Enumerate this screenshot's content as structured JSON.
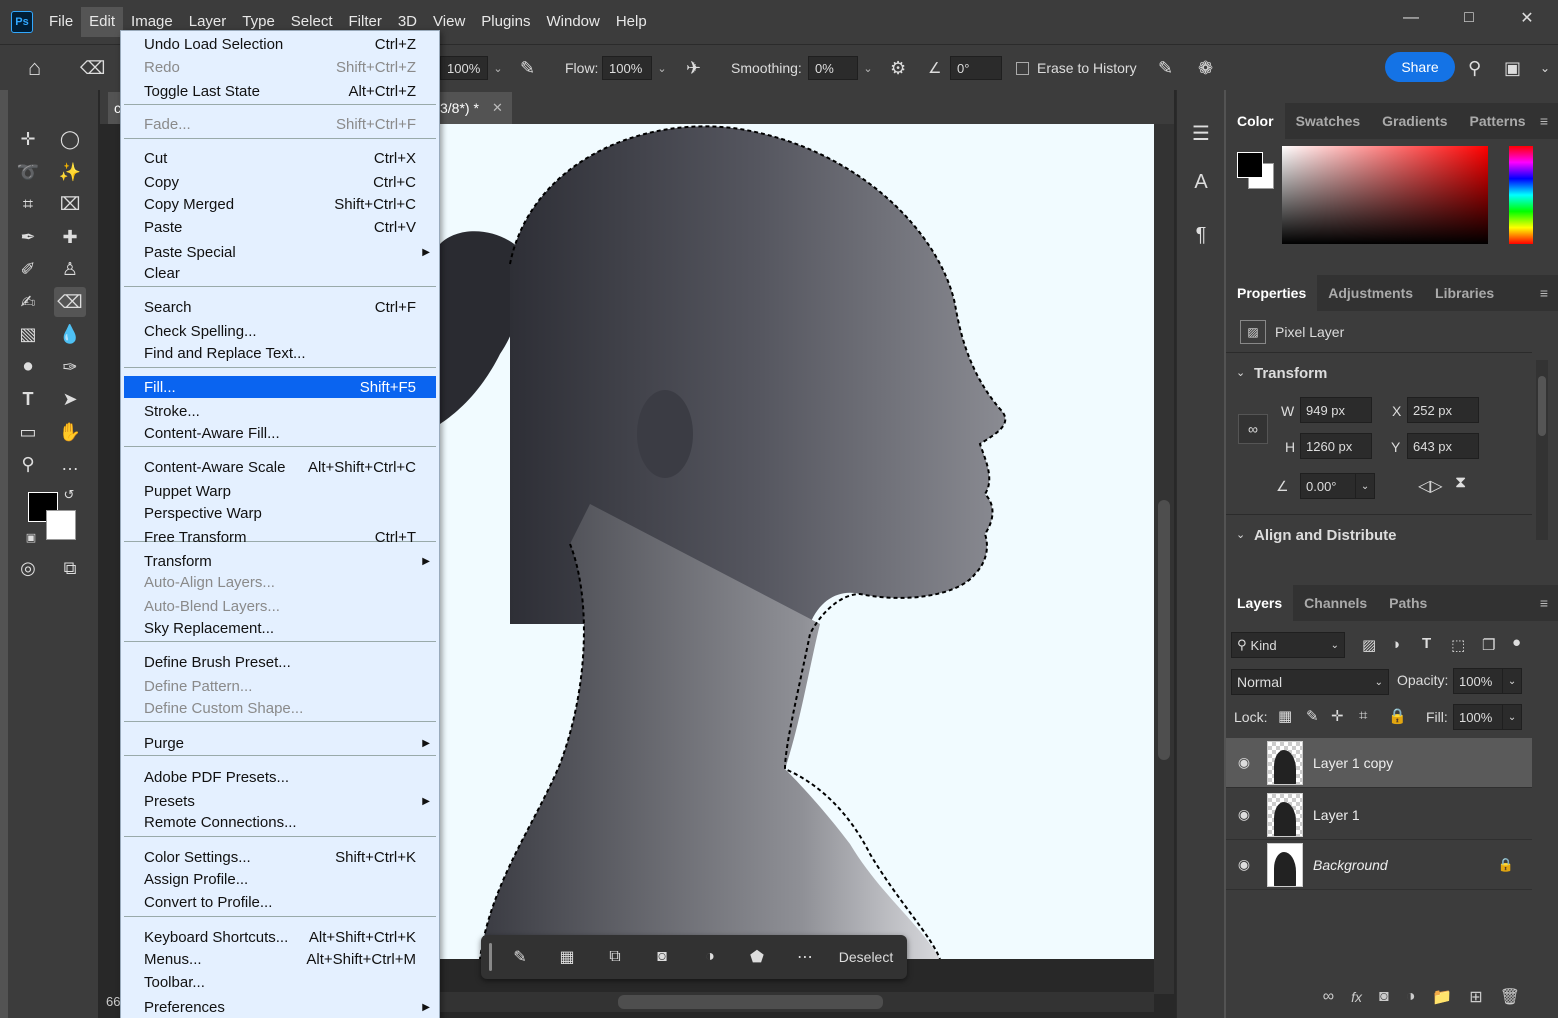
{
  "app": {
    "logo": "Ps"
  },
  "menubar": {
    "items": [
      "File",
      "Edit",
      "Image",
      "Layer",
      "Type",
      "Select",
      "Filter",
      "3D",
      "View",
      "Plugins",
      "Window",
      "Help"
    ],
    "active": "Edit"
  },
  "options": {
    "opacity_value": "100%",
    "flow_label": "Flow:",
    "flow_value": "100%",
    "smoothing_label": "Smoothing:",
    "smoothing_value": "0%",
    "angle_value": "0°",
    "erase_to_history": "Erase to History",
    "share": "Share"
  },
  "document": {
    "tab_title_visible": "3/8*) *",
    "tab_prefix": "c",
    "zoom": "66"
  },
  "edit_menu": {
    "items": [
      {
        "label": "Undo Load Selection",
        "shortcut": "Ctrl+Z",
        "disabled": false
      },
      {
        "label": "Redo",
        "shortcut": "Shift+Ctrl+Z",
        "disabled": true
      },
      {
        "label": "Toggle Last State",
        "shortcut": "Alt+Ctrl+Z",
        "disabled": false
      },
      {
        "label": "Fade...",
        "shortcut": "Shift+Ctrl+F",
        "disabled": true
      },
      {
        "label": "Cut",
        "shortcut": "Ctrl+X",
        "disabled": false
      },
      {
        "label": "Copy",
        "shortcut": "Ctrl+C",
        "disabled": false
      },
      {
        "label": "Copy Merged",
        "shortcut": "Shift+Ctrl+C",
        "disabled": false
      },
      {
        "label": "Paste",
        "shortcut": "Ctrl+V",
        "disabled": false
      },
      {
        "label": "Paste Special",
        "shortcut": "",
        "submenu": true
      },
      {
        "label": "Clear",
        "shortcut": ""
      },
      {
        "label": "Search",
        "shortcut": "Ctrl+F"
      },
      {
        "label": "Check Spelling...",
        "shortcut": ""
      },
      {
        "label": "Find and Replace Text...",
        "shortcut": ""
      },
      {
        "label": "Fill...",
        "shortcut": "Shift+F5",
        "highlighted": true
      },
      {
        "label": "Stroke...",
        "shortcut": ""
      },
      {
        "label": "Content-Aware Fill...",
        "shortcut": ""
      },
      {
        "label": "Content-Aware Scale",
        "shortcut": "Alt+Shift+Ctrl+C"
      },
      {
        "label": "Puppet Warp",
        "shortcut": ""
      },
      {
        "label": "Perspective Warp",
        "shortcut": ""
      },
      {
        "label": "Free Transform",
        "shortcut": "Ctrl+T"
      },
      {
        "label": "Transform",
        "shortcut": "",
        "submenu": true
      },
      {
        "label": "Auto-Align Layers...",
        "shortcut": "",
        "disabled": true
      },
      {
        "label": "Auto-Blend Layers...",
        "shortcut": "",
        "disabled": true
      },
      {
        "label": "Sky Replacement...",
        "shortcut": ""
      },
      {
        "label": "Define Brush Preset...",
        "shortcut": ""
      },
      {
        "label": "Define Pattern...",
        "shortcut": "",
        "disabled": true
      },
      {
        "label": "Define Custom Shape...",
        "shortcut": "",
        "disabled": true
      },
      {
        "label": "Purge",
        "shortcut": "",
        "submenu": true
      },
      {
        "label": "Adobe PDF Presets...",
        "shortcut": ""
      },
      {
        "label": "Presets",
        "shortcut": "",
        "submenu": true
      },
      {
        "label": "Remote Connections...",
        "shortcut": ""
      },
      {
        "label": "Color Settings...",
        "shortcut": "Shift+Ctrl+K"
      },
      {
        "label": "Assign Profile...",
        "shortcut": ""
      },
      {
        "label": "Convert to Profile...",
        "shortcut": ""
      },
      {
        "label": "Keyboard Shortcuts...",
        "shortcut": "Alt+Shift+Ctrl+K"
      },
      {
        "label": "Menus...",
        "shortcut": "Alt+Shift+Ctrl+M"
      },
      {
        "label": "Toolbar...",
        "shortcut": ""
      },
      {
        "label": "Preferences",
        "shortcut": "",
        "submenu": true
      }
    ]
  },
  "color_panel": {
    "tabs": [
      "Color",
      "Swatches",
      "Gradients",
      "Patterns"
    ],
    "active": "Color",
    "foreground": "#000000",
    "background": "#ffffff"
  },
  "properties_panel": {
    "tabs": [
      "Properties",
      "Adjustments",
      "Libraries"
    ],
    "active": "Properties",
    "layer_type": "Pixel Layer",
    "transform_title": "Transform",
    "w_label": "W",
    "w": "949 px",
    "h_label": "H",
    "h": "1260 px",
    "x_label": "X",
    "x": "252 px",
    "y_label": "Y",
    "y": "643 px",
    "angle": "0.00°",
    "align_title": "Align and Distribute"
  },
  "layers_panel": {
    "tabs": [
      "Layers",
      "Channels",
      "Paths"
    ],
    "active": "Layers",
    "filter_kind": "Kind",
    "blend_mode": "Normal",
    "opacity_label": "Opacity:",
    "opacity": "100%",
    "lock_label": "Lock:",
    "fill_label": "Fill:",
    "fill": "100%",
    "layers": [
      {
        "name": "Layer 1 copy",
        "selected": true
      },
      {
        "name": "Layer 1",
        "selected": false
      },
      {
        "name": "Background",
        "selected": false,
        "locked": true
      }
    ]
  },
  "context_bar": {
    "deselect": "Deselect"
  },
  "colors": {
    "accent": "#1473e6",
    "menu_highlight": "#0a64f0",
    "menu_bg": "#e4f0ff"
  }
}
